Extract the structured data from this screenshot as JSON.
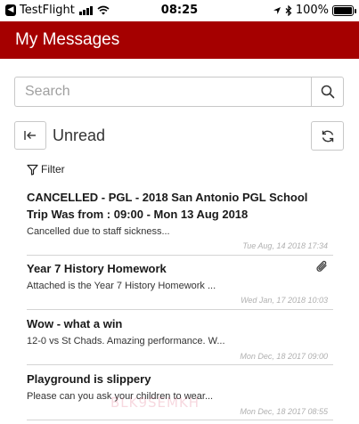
{
  "status_bar": {
    "back_app": "TestFlight",
    "time": "08:25",
    "battery": "100%",
    "battery_level": 1.0
  },
  "header": {
    "title": "My Messages"
  },
  "search": {
    "placeholder": "Search",
    "value": ""
  },
  "list_controls": {
    "folder_label": "Unread",
    "filter_label": "Filter"
  },
  "messages": [
    {
      "title": "CANCELLED - PGL - 2018 San Antonio PGL School Trip Was from : 09:00 - Mon 13 Aug 2018",
      "preview": "Cancelled due to staff sickness...",
      "date": "Tue Aug, 14 2018 17:34",
      "has_attachment": false
    },
    {
      "title": "Year 7 History Homework",
      "preview": "Attached is the Year 7 History Homework ...",
      "date": "Wed Jan, 17 2018 10:03",
      "has_attachment": true
    },
    {
      "title": "Wow - what a win",
      "preview": "12-0 vs St Chads. Amazing performance. W...",
      "date": "Mon Dec, 18 2017 09:00",
      "has_attachment": false
    },
    {
      "title": "Playground is slippery",
      "preview": "Please can you ask your children to wear...",
      "date": "Mon Dec, 18 2017 08:55",
      "has_attachment": false
    }
  ],
  "watermark": "BLK9SEMKH",
  "colors": {
    "header_bg": "#a50000",
    "header_text": "#ffffff",
    "date_text": "#b0b0b0",
    "border": "#c8c8c8"
  },
  "icons": [
    "back-chevron-icon",
    "signal-icon",
    "wifi-icon",
    "location-icon",
    "bluetooth-icon",
    "battery-icon",
    "search-icon",
    "collapse-left-icon",
    "refresh-icon",
    "filter-icon",
    "paperclip-icon"
  ]
}
